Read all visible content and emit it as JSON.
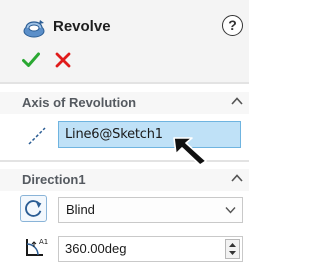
{
  "feature": {
    "title": "Revolve",
    "icon": "revolve-icon",
    "help_icon": "help-icon",
    "help_label": "?",
    "ok_icon": "checkmark-icon",
    "cancel_icon": "close-icon"
  },
  "axis_section": {
    "title": "Axis of Revolution",
    "collapse_icon": "chevron-up-icon",
    "axis_icon": "axis-line-icon",
    "axis_value": "Line6@Sketch1"
  },
  "direction_section": {
    "title": "Direction1",
    "collapse_icon": "chevron-up-icon",
    "reverse_icon": "reverse-direction-icon",
    "end_condition": "Blind",
    "angle_icon": "angle-icon",
    "angle_value": "360.00deg"
  },
  "colors": {
    "ok": "#2aa832",
    "cancel": "#e01b1b",
    "selection_fill": "#bfe1f7",
    "selection_border": "#6fb4e0",
    "section_title": "#555a60"
  }
}
